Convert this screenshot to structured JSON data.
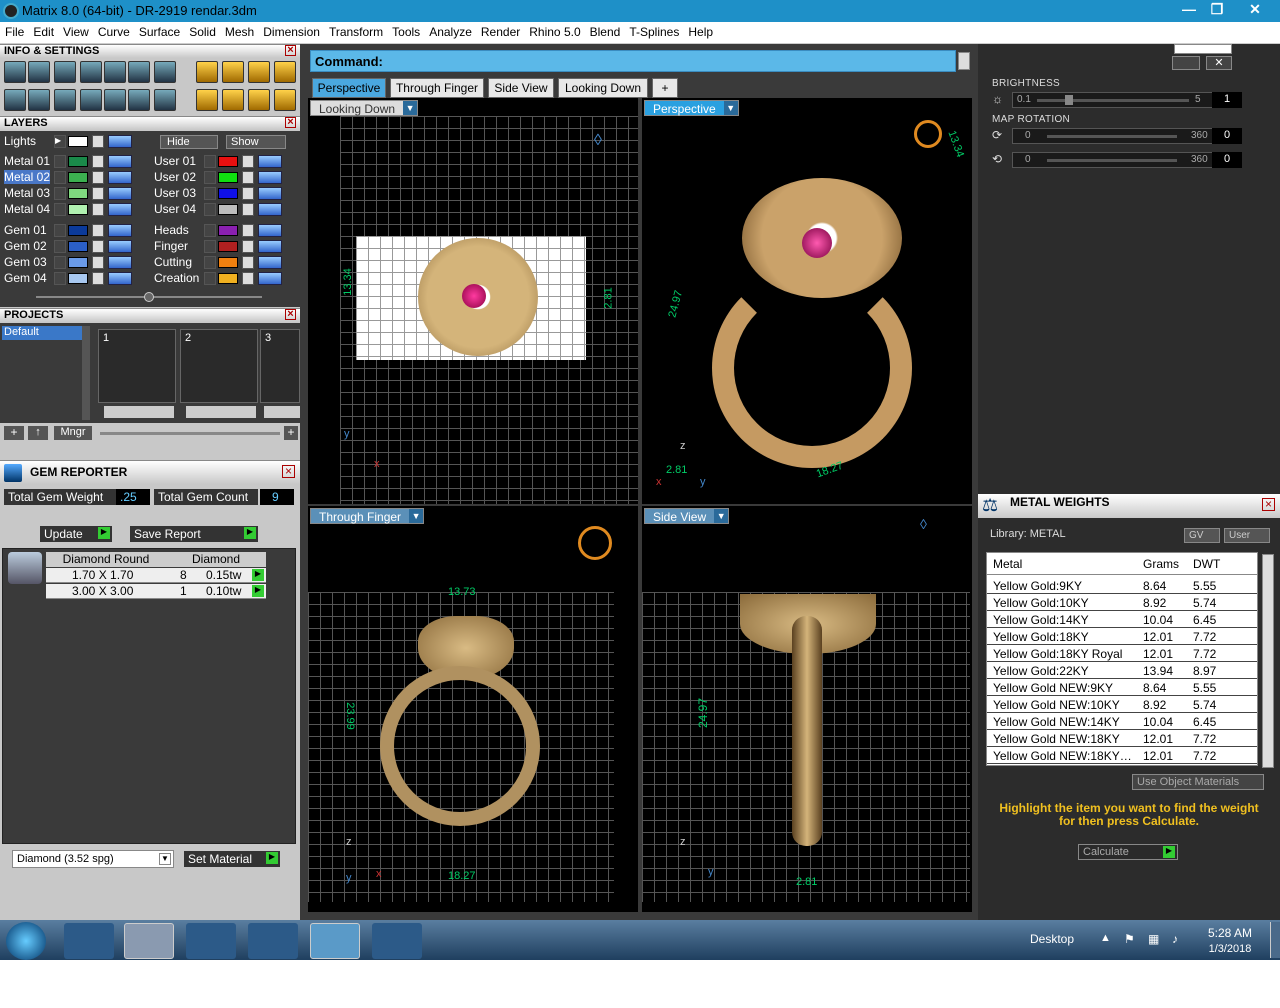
{
  "window": {
    "title": "Matrix 8.0 (64-bit) - DR-2919 rendar.3dm"
  },
  "menu": [
    "File",
    "Edit",
    "View",
    "Curve",
    "Surface",
    "Solid",
    "Mesh",
    "Dimension",
    "Transform",
    "Tools",
    "Analyze",
    "Render",
    "Rhino 5.0",
    "Blend",
    "T-Splines",
    "Help"
  ],
  "panels": {
    "info_settings": "INFO & SETTINGS",
    "layers": "LAYERS",
    "projects": "PROJECTS",
    "gem_reporter": "GEM REPORTER",
    "metal_weights": "METAL WEIGHTS"
  },
  "layers": {
    "lights": "Lights",
    "hide": "Hide",
    "show": "Show",
    "left": [
      "Metal 01",
      "Metal 02",
      "Metal 03",
      "Metal 04",
      "Gem 01",
      "Gem 02",
      "Gem 03",
      "Gem 04"
    ],
    "right": [
      "User 01",
      "User 02",
      "User 03",
      "User 04",
      "Heads",
      "Finger",
      "Cutting",
      "Creation"
    ],
    "left_colors": [
      "#1a8a4a",
      "#3cb050",
      "#7fd87f",
      "#b0f0b0",
      "#0b3a9a",
      "#2b5fc8",
      "#6a9ae8",
      "#a8c8f0"
    ],
    "right_colors": [
      "#e81010",
      "#10e010",
      "#1010e8",
      "#bdbdbd",
      "#8a20b0",
      "#b02020",
      "#f08010",
      "#f0b020"
    ]
  },
  "projects": {
    "default": "Default",
    "slots": [
      "1",
      "2",
      "3"
    ],
    "mngr": "Mngr"
  },
  "gem": {
    "total_weight_label": "Total Gem Weight",
    "total_weight": ".25",
    "total_count_label": "Total Gem Count",
    "total_count": "9",
    "update": "Update",
    "save_report": "Save Report",
    "col1": "Diamond Round",
    "col2": "Diamond",
    "rows": [
      {
        "size": "1.70 X 1.70",
        "count": "8",
        "tw": "0.15tw"
      },
      {
        "size": "3.00 X 3.00",
        "count": "1",
        "tw": "0.10tw"
      }
    ],
    "material": "Diamond     (3.52 spg)",
    "set_material": "Set Material"
  },
  "command": {
    "label": "Command:"
  },
  "tabs": [
    "Perspective",
    "Through Finger",
    "Side View",
    "Looking Down"
  ],
  "viewports": {
    "looking_down": "Looking Down",
    "perspective": "Perspective",
    "through_finger": "Through Finger",
    "side_view": "Side View",
    "dims": {
      "ld_v": "13.34",
      "ld_h": "2.81",
      "tf_top": "13.73",
      "tf_v": "23.99",
      "tf_bot": "18.27",
      "sv_v": "24.97",
      "sv_bot": "2.81",
      "p1": "13.34",
      "p2": "2.81",
      "p3": "18.27",
      "p4": "24.97"
    }
  },
  "render": {
    "brightness_label": "BRIGHTNESS",
    "b_min": "0.1",
    "b_max": "5",
    "b_val": "1",
    "map_rotation": "MAP ROTATION",
    "r1_min": "0",
    "r1_max": "360",
    "r1_val": "0",
    "r2_min": "0",
    "r2_max": "360",
    "r2_val": "0"
  },
  "metal": {
    "library": "Library: METAL",
    "gv": "GV",
    "user": "User",
    "headers": [
      "Metal",
      "Grams",
      "DWT"
    ],
    "rows": [
      [
        "Yellow Gold:9KY",
        "8.64",
        "5.55"
      ],
      [
        "Yellow Gold:10KY",
        "8.92",
        "5.74"
      ],
      [
        "Yellow Gold:14KY",
        "10.04",
        "6.45"
      ],
      [
        "Yellow Gold:18KY",
        "12.01",
        "7.72"
      ],
      [
        "Yellow Gold:18KY Royal",
        "12.01",
        "7.72"
      ],
      [
        "Yellow Gold:22KY",
        "13.94",
        "8.97"
      ],
      [
        "Yellow Gold NEW:9KY",
        "8.64",
        "5.55"
      ],
      [
        "Yellow Gold NEW:10KY",
        "8.92",
        "5.74"
      ],
      [
        "Yellow Gold NEW:14KY",
        "10.04",
        "6.45"
      ],
      [
        "Yellow Gold NEW:18KY",
        "12.01",
        "7.72"
      ],
      [
        "Yellow Gold NEW:18KY…",
        "12.01",
        "7.72"
      ]
    ],
    "use_object": "Use Object Materials",
    "hint": "Highlight the item you want to find the weight for then press Calculate.",
    "calculate": "Calculate"
  },
  "taskbar": {
    "desktop": "Desktop",
    "time": "5:28 AM",
    "date": "1/3/2018"
  }
}
